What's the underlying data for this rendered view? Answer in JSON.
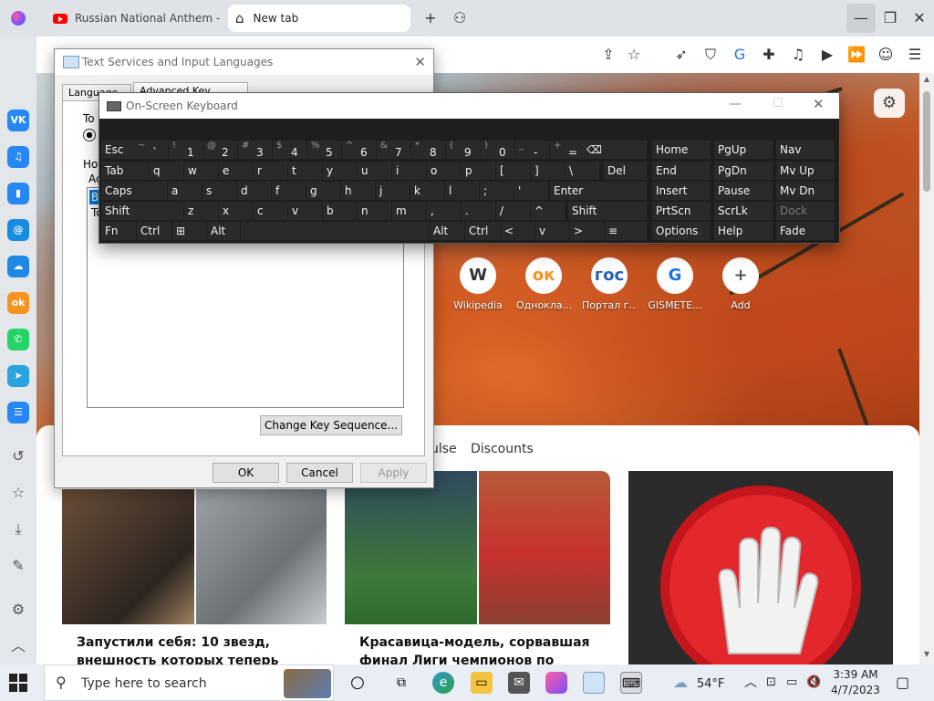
{
  "browser": {
    "tabs": [
      {
        "title": "Russian National Anthem - \"G"
      },
      {
        "title": "New tab"
      }
    ]
  },
  "sidebar": {
    "apps": [
      {
        "name": "vk",
        "label": "VK",
        "color": "#2787f5"
      },
      {
        "name": "music",
        "label": "♫",
        "color": "#2787f5"
      },
      {
        "name": "stats",
        "label": "▮",
        "color": "#2787f5"
      },
      {
        "name": "mail",
        "label": "@",
        "color": "#168de2"
      },
      {
        "name": "cloud",
        "label": "☁",
        "color": "#1e88e5"
      },
      {
        "name": "ok",
        "label": "ok",
        "color": "#f7931e"
      },
      {
        "name": "whatsapp",
        "label": "✆",
        "color": "#25d366"
      },
      {
        "name": "telegram",
        "label": "➤",
        "color": "#2aa3e0"
      },
      {
        "name": "list",
        "label": "☰",
        "color": "#2787f5"
      }
    ]
  },
  "shortcuts": [
    {
      "label": "Wikipedia",
      "glyph": "W",
      "color": "#333"
    },
    {
      "label": "Однокла...",
      "glyph": "ок",
      "color": "#f7931e"
    },
    {
      "label": "Портал г...",
      "glyph": "гос",
      "color": "#2b5fb8"
    },
    {
      "label": "GISMETE...",
      "glyph": "G",
      "color": "#1a73e8"
    },
    {
      "label": "Add",
      "glyph": "+",
      "color": "#555"
    }
  ],
  "feed": {
    "tabs": [
      "ulse",
      "Discounts"
    ],
    "cards": [
      {
        "title": "Запустили себя: 10 звезд, внешность которых теперь"
      },
      {
        "title": "Красавица-модель, сорвавшая финал Лиги чемпионов по"
      }
    ]
  },
  "text_services": {
    "title": "Text Services and Input Languages",
    "tabs": [
      "Language Bar",
      "Advanced Key Settings"
    ],
    "fragments": {
      "to": "To t",
      "hot": "Hot",
      "ac": "Ac",
      "be": "Be",
      "to2": "To"
    },
    "change_seq": "Change Key Sequence...",
    "ok": "OK",
    "cancel": "Cancel",
    "apply": "Apply"
  },
  "osk": {
    "title": "On-Screen Keyboard",
    "row1": [
      {
        "sub": "",
        "main": "Esc"
      },
      {
        "sub": "~",
        "main": "`"
      },
      {
        "sub": "!",
        "main": "1"
      },
      {
        "sub": "@",
        "main": "2"
      },
      {
        "sub": "#",
        "main": "3"
      },
      {
        "sub": "$",
        "main": "4"
      },
      {
        "sub": "%",
        "main": "5"
      },
      {
        "sub": "^",
        "main": "6"
      },
      {
        "sub": "&",
        "main": "7"
      },
      {
        "sub": "*",
        "main": "8"
      },
      {
        "sub": "(",
        "main": "9"
      },
      {
        "sub": ")",
        "main": "0"
      },
      {
        "sub": "_",
        "main": "-"
      },
      {
        "sub": "+",
        "main": "="
      },
      {
        "sub": "",
        "main": "⌫"
      }
    ],
    "row2": [
      "Tab",
      "q",
      "w",
      "e",
      "r",
      "t",
      "y",
      "u",
      "i",
      "o",
      "p",
      "[",
      "]",
      "\\",
      "Del"
    ],
    "row3": [
      "Caps",
      "a",
      "s",
      "d",
      "f",
      "g",
      "h",
      "j",
      "k",
      "l",
      ";",
      "'",
      "Enter"
    ],
    "row4": [
      "Shift",
      "z",
      "x",
      "c",
      "v",
      "b",
      "n",
      "m",
      ",",
      ".",
      "/",
      "^",
      "Shift"
    ],
    "row5": [
      "Fn",
      "Ctrl",
      "⊞",
      "Alt",
      "",
      "Alt",
      "Ctrl",
      "<",
      "v",
      ">",
      "≡"
    ],
    "nav": [
      [
        "Home",
        "PgUp",
        "Nav"
      ],
      [
        "End",
        "PgDn",
        "Mv Up"
      ],
      [
        "Insert",
        "Pause",
        "Mv Dn"
      ],
      [
        "PrtScn",
        "ScrLk",
        "Dock"
      ],
      [
        "Options",
        "Help",
        "Fade"
      ]
    ]
  },
  "taskbar": {
    "search_placeholder": "Type here to search",
    "weather": "54°F",
    "time": "3:39 AM",
    "date": "4/7/2023"
  }
}
